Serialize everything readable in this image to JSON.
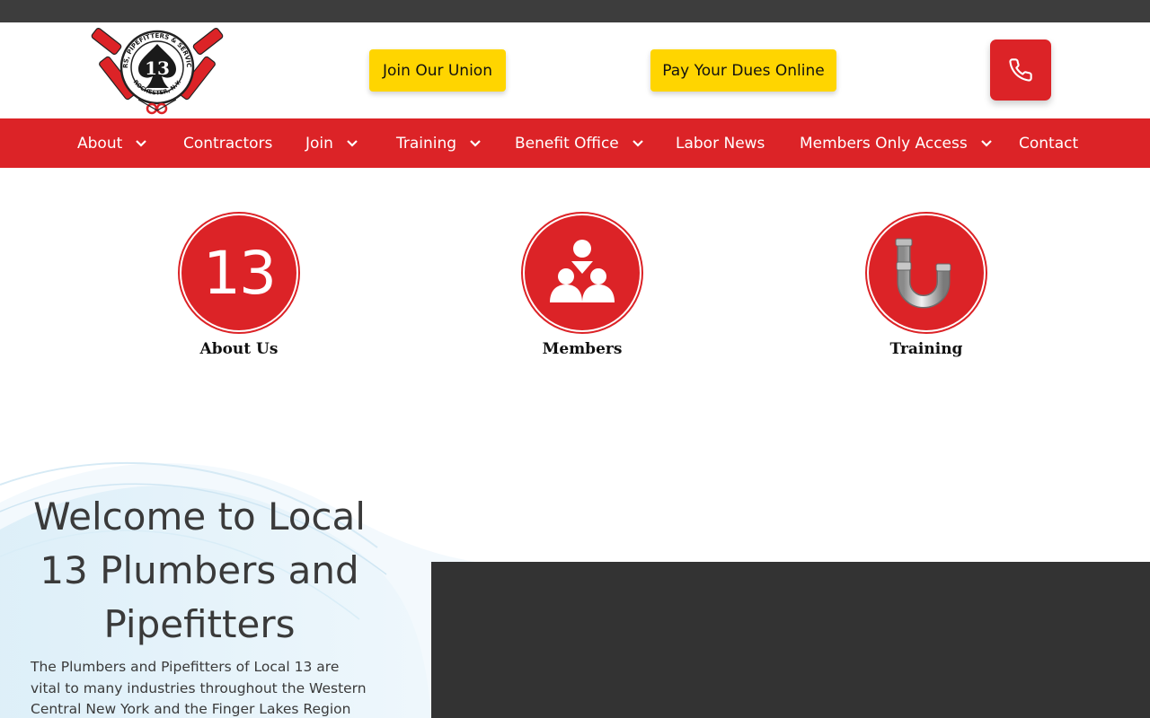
{
  "header": {
    "logo": {
      "center_number": "13",
      "ring_text": "PLUMBERS, PIPEFITTERS & SERVICE TECHS",
      "bottom_text": "ROCHESTER, N.Y."
    },
    "join_label": "Join Our Union",
    "dues_label": "Pay Your Dues Online",
    "phone_icon": "phone-icon"
  },
  "nav": {
    "items": [
      {
        "label": "About",
        "dropdown": true
      },
      {
        "label": "Contractors",
        "dropdown": false
      },
      {
        "label": "Join",
        "dropdown": true
      },
      {
        "label": "Training",
        "dropdown": true
      },
      {
        "label": "Benefit Office",
        "dropdown": true
      },
      {
        "label": "Labor News",
        "dropdown": false
      },
      {
        "label": "Members Only Access",
        "dropdown": true
      },
      {
        "label": "Contact",
        "dropdown": false
      }
    ]
  },
  "features": [
    {
      "label": "About Us",
      "icon_text": "13"
    },
    {
      "label": "Members",
      "icon": "people-group-icon"
    },
    {
      "label": "Training",
      "icon": "pipe-icon"
    }
  ],
  "welcome": {
    "title": "Welcome to Local 13 Plumbers and Pipefitters",
    "text": "The Plumbers and Pipefitters of Local 13 are vital to many industries throughout the Western Central New York and the Finger Lakes Region"
  },
  "colors": {
    "brand_red": "#dc2327",
    "button_yellow": "#ffd500",
    "top_bar": "#3d3d3d",
    "video_bg": "#333333"
  }
}
